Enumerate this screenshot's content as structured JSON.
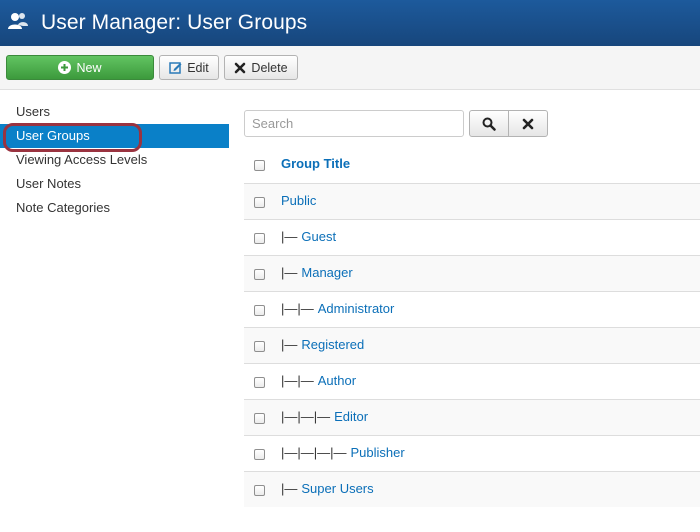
{
  "header": {
    "title": "User Manager: User Groups"
  },
  "toolbar": {
    "new_label": "New",
    "edit_label": "Edit",
    "delete_label": "Delete"
  },
  "sidebar": {
    "items": [
      {
        "label": "Users"
      },
      {
        "label": "User Groups",
        "active": true
      },
      {
        "label": "Viewing Access Levels"
      },
      {
        "label": "User Notes"
      },
      {
        "label": "Note Categories"
      }
    ]
  },
  "search": {
    "placeholder": "Search",
    "value": ""
  },
  "table": {
    "column_header": "Group Title",
    "rows": [
      {
        "prefix": "",
        "title": "Public"
      },
      {
        "prefix": "|—",
        "title": "Guest"
      },
      {
        "prefix": "|—",
        "title": "Manager"
      },
      {
        "prefix": "|—|—",
        "title": "Administrator"
      },
      {
        "prefix": "|—",
        "title": "Registered"
      },
      {
        "prefix": "|—|—",
        "title": "Author"
      },
      {
        "prefix": "|—|—|—",
        "title": "Editor"
      },
      {
        "prefix": "|—|—|—|—",
        "title": "Publisher"
      },
      {
        "prefix": "|—",
        "title": "Super Users"
      }
    ]
  },
  "colors": {
    "header_bg": "#17467c",
    "active_item": "#0a80c8",
    "new_button": "#4cae4c",
    "link": "#0b6fb8",
    "highlight_ring": "#9a3340"
  }
}
